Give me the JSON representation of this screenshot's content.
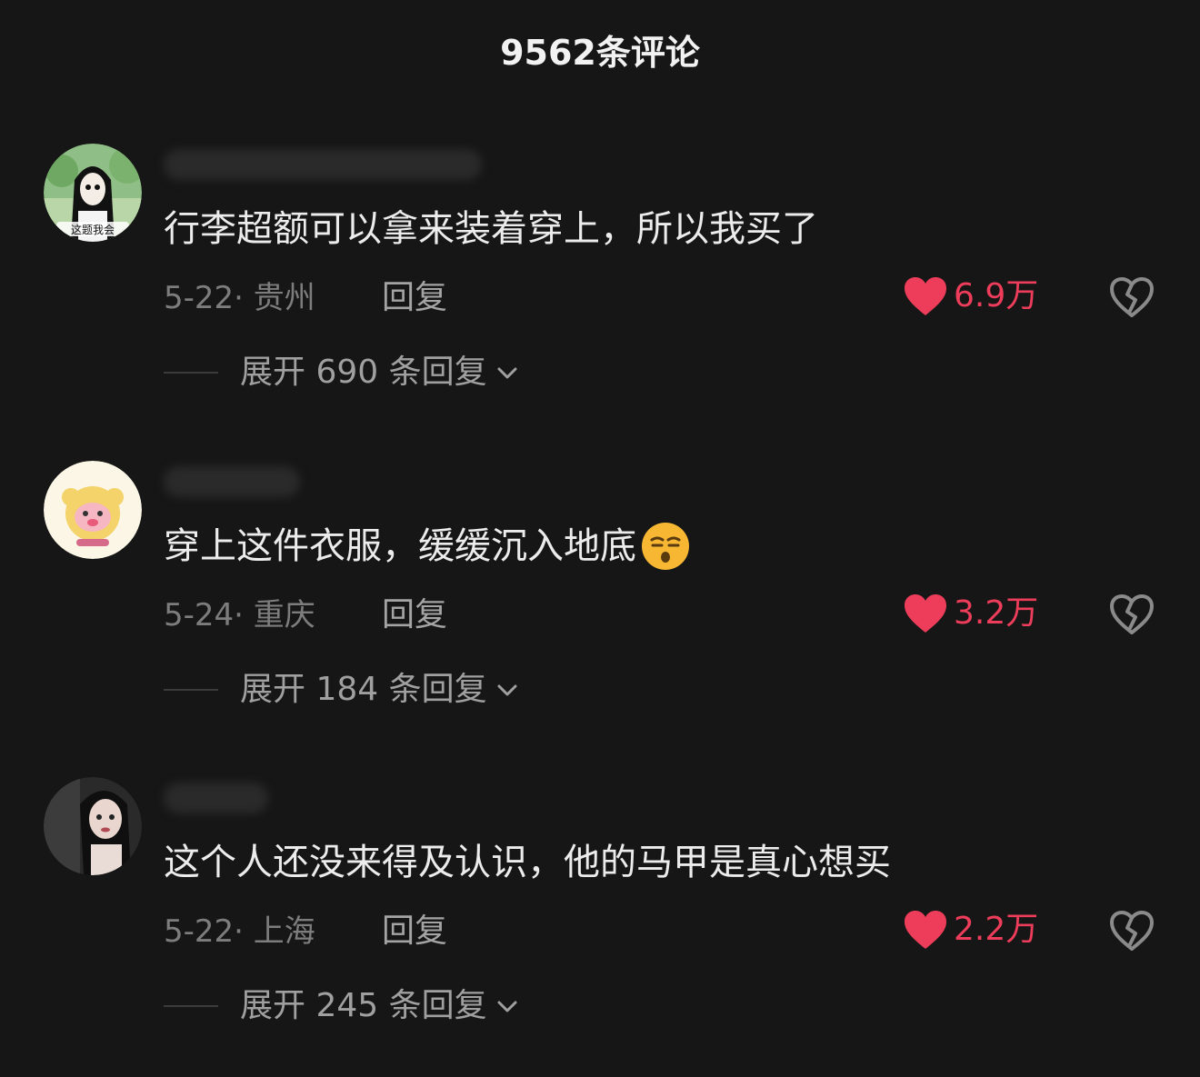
{
  "header": {
    "title": "9562条评论"
  },
  "colors": {
    "background": "#161616",
    "like": "#ee3d5a",
    "meta": "#7d7d7d"
  },
  "comments": [
    {
      "avatar_caption": "这题我会",
      "text": "行李超额可以拿来装着穿上，所以我买了",
      "meta": "5-22· 贵州",
      "reply_label": "回复",
      "likes": "6.9万",
      "expand_label": "展开 690 条回复",
      "emoji": null
    },
    {
      "avatar_caption": "",
      "text": "穿上这件衣服，缓缓沉入地底",
      "meta": "5-24· 重庆",
      "reply_label": "回复",
      "likes": "3.2万",
      "expand_label": "展开 184 条回复",
      "emoji": "sleepy-face-emoji"
    },
    {
      "avatar_caption": "",
      "text": "这个人还没来得及认识，他的马甲是真心想买",
      "meta": "5-22· 上海",
      "reply_label": "回复",
      "likes": "2.2万",
      "expand_label": "展开 245 条回复",
      "emoji": null
    }
  ]
}
